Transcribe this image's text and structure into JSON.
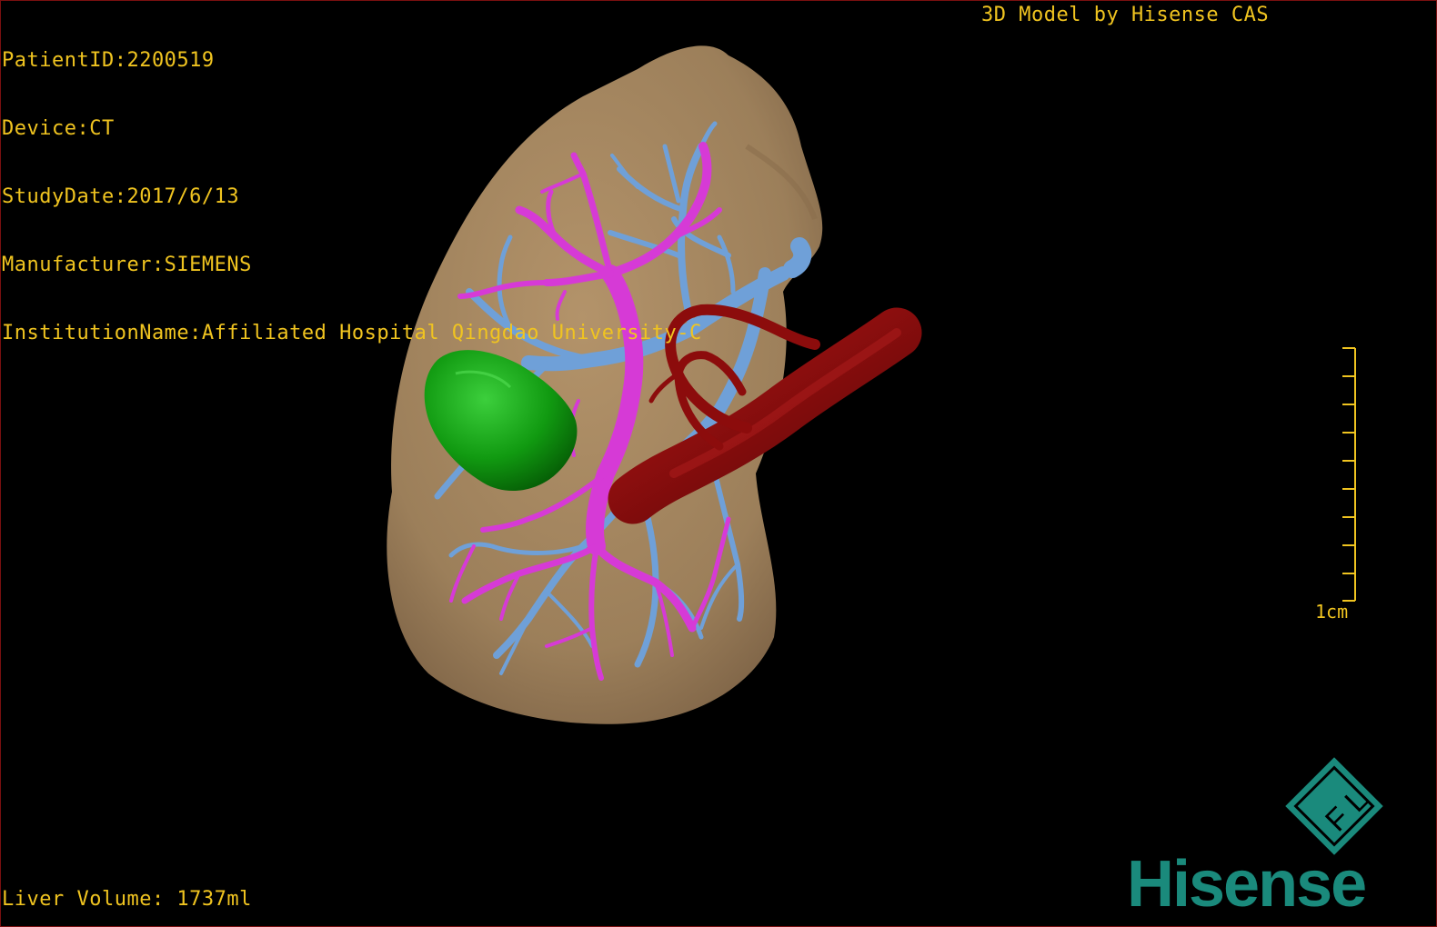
{
  "study_info": {
    "patient_id": "PatientID:2200519",
    "device": "Device:CT",
    "study_date": "StudyDate:2017/6/13",
    "manufacturer": "Manufacturer:SIEMENS",
    "institution": "InstitutionName:Affiliated Hospital Qingdao University-C"
  },
  "credit": "3D Model by Hisense CAS",
  "liver_volume": "Liver Volume: 1737ml",
  "scale_bar": {
    "label": "1cm"
  },
  "logo": {
    "brand": "Hisense",
    "mark": "F L"
  },
  "colors": {
    "overlay_text": "#f0c420",
    "liver": "#9c7f5a",
    "portal_vein": "#6fa0d8",
    "hepatic_vein": "#d63ad6",
    "artery": "#8c0c0c",
    "lesion": "#1a9a1a",
    "logo": "#1a8a7c"
  }
}
